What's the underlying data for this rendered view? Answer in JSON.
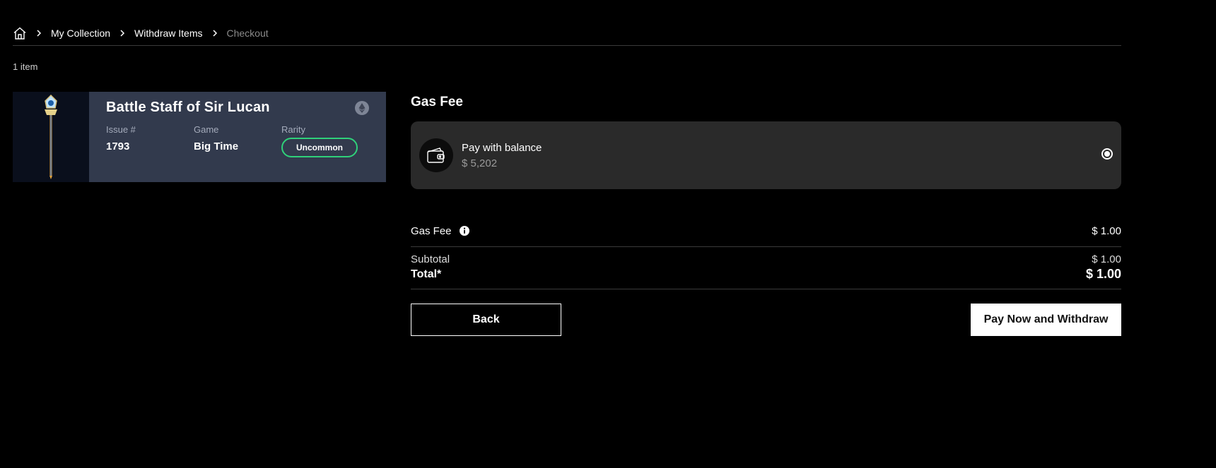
{
  "breadcrumb": {
    "items": [
      "My Collection",
      "Withdraw Items"
    ],
    "current": "Checkout"
  },
  "item_count": "1 item",
  "item": {
    "title": "Battle Staff of Sir Lucan",
    "issue_label": "Issue #",
    "issue_value": "1793",
    "game_label": "Game",
    "game_value": "Big Time",
    "rarity_label": "Rarity",
    "rarity_value": "Uncommon",
    "rarity_color": "#2fd17a",
    "card_bg": "#323a4d"
  },
  "gas_fee": {
    "section_title": "Gas Fee",
    "option_label": "Pay with balance",
    "option_amount": "$ 5,202",
    "option_selected": true
  },
  "summary": {
    "gas_fee_label": "Gas Fee",
    "gas_fee_value": "$ 1.00",
    "subtotal_label": "Subtotal",
    "subtotal_value": "$ 1.00",
    "total_label": "Total*",
    "total_value": "$ 1.00"
  },
  "actions": {
    "back_label": "Back",
    "pay_label": "Pay Now and Withdraw"
  },
  "icons": {
    "home": "home-icon",
    "chevron": "chevron-right-icon",
    "chain": "ethereum-icon",
    "wallet": "wallet-icon",
    "info": "info-icon"
  }
}
